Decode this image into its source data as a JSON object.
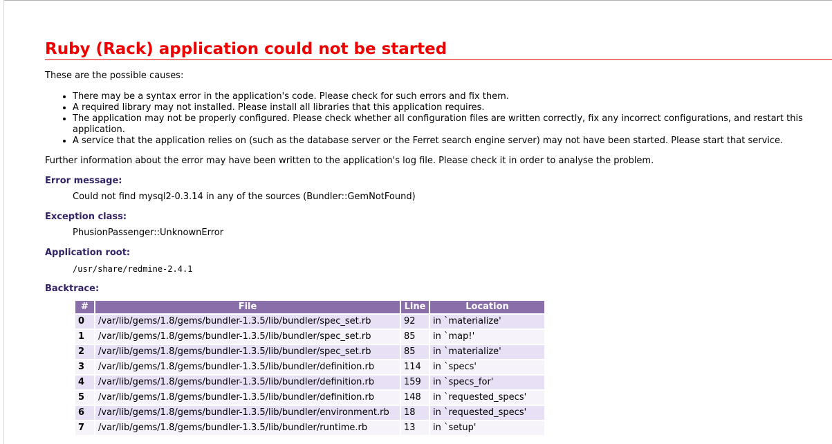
{
  "page": {
    "title": "Ruby (Rack) application could not be started",
    "intro": "These are the possible causes:",
    "causes": [
      "There may be a syntax error in the application's code. Please check for such errors and fix them.",
      "A required library may not installed. Please install all libraries that this application requires.",
      "The application may not be properly configured. Please check whether all configuration files are written correctly, fix any incorrect configurations, and restart this application.",
      "A service that the application relies on (such as the database server or the Ferret search engine server) may not have been started. Please start that service."
    ],
    "further_info": "Further information about the error may have been written to the application's log file. Please check it in order to analyse the problem.",
    "error_message": {
      "heading": "Error message:",
      "value": "Could not find mysql2-0.3.14 in any of the sources (Bundler::GemNotFound)"
    },
    "exception_class": {
      "heading": "Exception class:",
      "value": "PhusionPassenger::UnknownError"
    },
    "application_root": {
      "heading": "Application root:",
      "value": "/usr/share/redmine-2.4.1"
    },
    "backtrace": {
      "heading": "Backtrace:",
      "columns": [
        "#",
        "File",
        "Line",
        "Location"
      ],
      "rows": [
        {
          "num": "0",
          "file": "/var/lib/gems/1.8/gems/bundler-1.3.5/lib/bundler/spec_set.rb",
          "line": "92",
          "location": "in `materialize'"
        },
        {
          "num": "1",
          "file": "/var/lib/gems/1.8/gems/bundler-1.3.5/lib/bundler/spec_set.rb",
          "line": "85",
          "location": "in `map!'"
        },
        {
          "num": "2",
          "file": "/var/lib/gems/1.8/gems/bundler-1.3.5/lib/bundler/spec_set.rb",
          "line": "85",
          "location": "in `materialize'"
        },
        {
          "num": "3",
          "file": "/var/lib/gems/1.8/gems/bundler-1.3.5/lib/bundler/definition.rb",
          "line": "114",
          "location": "in `specs'"
        },
        {
          "num": "4",
          "file": "/var/lib/gems/1.8/gems/bundler-1.3.5/lib/bundler/definition.rb",
          "line": "159",
          "location": "in `specs_for'"
        },
        {
          "num": "5",
          "file": "/var/lib/gems/1.8/gems/bundler-1.3.5/lib/bundler/definition.rb",
          "line": "148",
          "location": "in `requested_specs'"
        },
        {
          "num": "6",
          "file": "/var/lib/gems/1.8/gems/bundler-1.3.5/lib/bundler/environment.rb",
          "line": "18",
          "location": "in `requested_specs'"
        },
        {
          "num": "7",
          "file": "/var/lib/gems/1.8/gems/bundler-1.3.5/lib/bundler/runtime.rb",
          "line": "13",
          "location": "in `setup'"
        }
      ]
    }
  },
  "colors": {
    "title_red": "#ee0000",
    "heading_purple": "#332266",
    "table_header": "#8a6eaa",
    "row_odd": "#e8e0f4",
    "row_even": "#f6f3fb"
  }
}
